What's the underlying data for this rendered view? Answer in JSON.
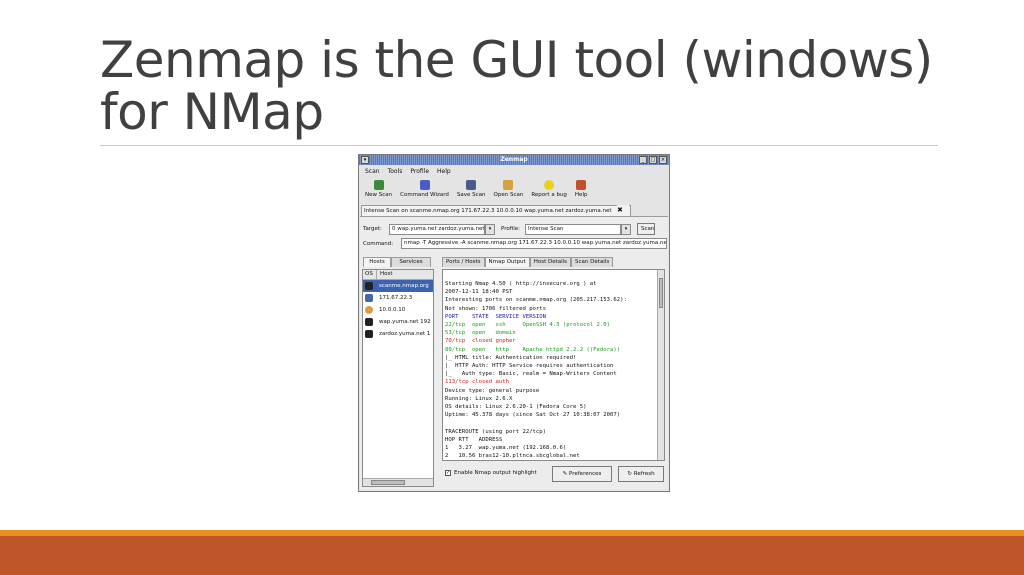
{
  "slide": {
    "title_line1": "Zenmap is the GUI tool (windows)",
    "title_line2": "for NMap"
  },
  "window": {
    "title": "Zenmap",
    "menu": [
      "Scan",
      "Tools",
      "Profile",
      "Help"
    ],
    "toolbar": [
      {
        "label": "New Scan",
        "icon": "new-scan-icon",
        "color": "#3a8a3a"
      },
      {
        "label": "Command Wizard",
        "icon": "wizard-icon",
        "color": "#4a5cc8"
      },
      {
        "label": "Save Scan",
        "icon": "save-icon",
        "color": "#4a5a8a"
      },
      {
        "label": "Open Scan",
        "icon": "folder-icon",
        "color": "#d8a040"
      },
      {
        "label": "Report a bug",
        "icon": "bulb-icon",
        "color": "#e8d020"
      },
      {
        "label": "Help",
        "icon": "help-icon",
        "color": "#c05030"
      }
    ],
    "scan_tab": "Intense Scan on scanme.nmap.org 171.67.22.3 10.0.0.10 wap.yuma.net zardoz.yuma.net",
    "target_label": "Target:",
    "target_value": "0 wap.yuma.net zardoz.yuma.net",
    "profile_label": "Profile:",
    "profile_value": "Intense Scan",
    "scan_button": "Scan",
    "command_label": "Command:",
    "command_value": "nmap -T Aggressive -A scanme.nmap.org 171.67.22.3 10.0.0.10 wap.yuma.net zardoz.yuma.net",
    "left_tabs": [
      "Hosts",
      "Services"
    ],
    "host_columns": [
      "OS",
      "Host"
    ],
    "hosts": [
      {
        "name": "scanme.nmap.org",
        "color": "#222222"
      },
      {
        "name": "171.67.22.3",
        "color": "#4466aa"
      },
      {
        "name": "10.0.0.10",
        "color": "#d8a040"
      },
      {
        "name": "wap.yuma.net 192",
        "color": "#222222"
      },
      {
        "name": "zardoz.yuma.net 1",
        "color": "#222222"
      }
    ],
    "output_tabs": [
      "Ports / Hosts",
      "Nmap Output",
      "Host Details",
      "Scan Details"
    ],
    "output_lines": [
      {
        "t": "Starting Nmap 4.50 ( http://insecure.org ) at",
        "c": "#111111"
      },
      {
        "t": "2007-12-11 18:40 PST",
        "c": "#111111"
      },
      {
        "t": "Interesting ports on scanme.nmap.org (205.217.153.62):",
        "c": "#111111"
      },
      {
        "t": "Not shown: 1706 filtered ports",
        "c": "#111111"
      },
      {
        "t": "PORT    STATE  SERVICE VERSION",
        "c": "#1a1aa0"
      },
      {
        "t": "22/tcp  open   ssh     OpenSSH 4.3 (protocol 2.0)",
        "c": "#1a9a1a"
      },
      {
        "t": "53/tcp  open   domain",
        "c": "#1a9a1a"
      },
      {
        "t": "70/tcp  closed gopher",
        "c": "#d02020"
      },
      {
        "t": "80/tcp  open   http    Apache httpd 2.2.2 ((Fedora))",
        "c": "#1a9a1a"
      },
      {
        "t": "|_ HTML title: Authentication required!",
        "c": "#111111"
      },
      {
        "t": "|  HTTP Auth: HTTP Service requires authentication",
        "c": "#111111"
      },
      {
        "t": "|_   Auth type: Basic, realm = Nmap-Writers Content",
        "c": "#111111"
      },
      {
        "t": "113/tcp closed auth",
        "c": "#d02020"
      },
      {
        "t": "Device type: general purpose",
        "c": "#111111"
      },
      {
        "t": "Running: Linux 2.6.X",
        "c": "#111111"
      },
      {
        "t": "OS details: Linux 2.6.20-1 (Fedora Core 5)",
        "c": "#111111"
      },
      {
        "t": "Uptime: 45.378 days (since Sat Oct 27 10:38:07 2007)",
        "c": "#111111"
      },
      {
        "t": "",
        "c": "#111111"
      },
      {
        "t": "TRACEROUTE (using port 22/tcp)",
        "c": "#111111"
      },
      {
        "t": "HOP RTT   ADDRESS",
        "c": "#111111"
      },
      {
        "t": "1   3.27  wap.yuma.net (192.168.0.6)",
        "c": "#111111"
      },
      {
        "t": "2   10.56 bras12-10.pltnca.sbcglobal.net",
        "c": "#111111"
      }
    ],
    "highlight_label": "Enable Nmap output highlight",
    "preferences_button": "Preferences",
    "refresh_button": "Refresh"
  },
  "colors": {
    "footer_orange": "#e8901f",
    "footer_rust": "#bf5528",
    "title_text": "#404040"
  }
}
